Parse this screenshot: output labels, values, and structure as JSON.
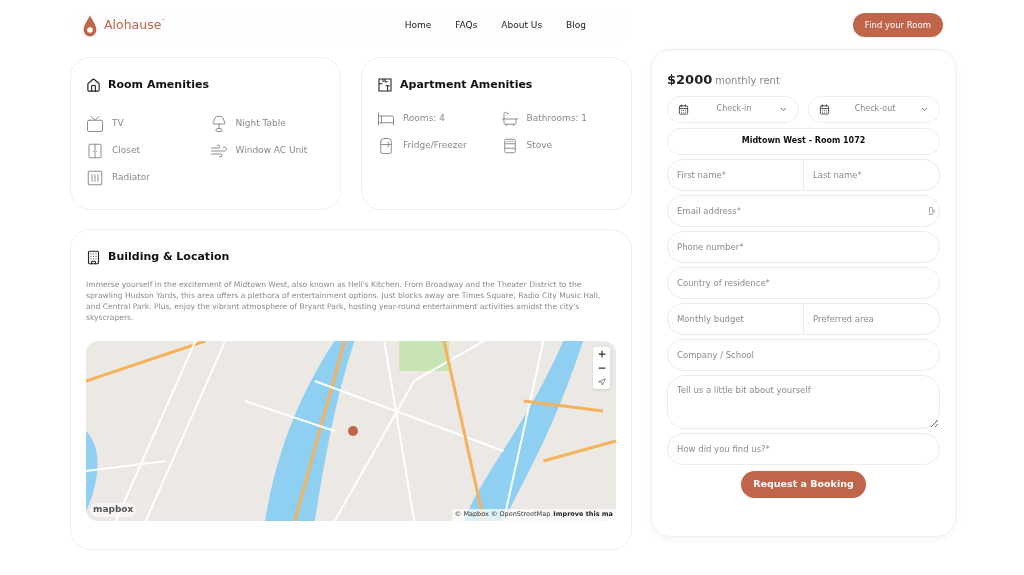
{
  "header": {
    "logo": "Alohause",
    "logo_mark": "™",
    "nav": [
      "Home",
      "FAQs",
      "About Us",
      "Blog"
    ],
    "cta": "Find your Room"
  },
  "room_amenities": {
    "title": "Room Amenities",
    "items": [
      {
        "kind": "tv",
        "label": "TV"
      },
      {
        "kind": "lamp",
        "label": "Night Table"
      },
      {
        "kind": "closet",
        "label": "Closet"
      },
      {
        "kind": "ac",
        "label": "Window AC Unit"
      },
      {
        "kind": "radiator",
        "label": "Radiator"
      }
    ]
  },
  "apartment_amenities": {
    "title": "Apartment Amenities",
    "items": [
      {
        "kind": "bed",
        "label": "Rooms: 4"
      },
      {
        "kind": "bath",
        "label": "Bathrooms: 1"
      },
      {
        "kind": "fridge",
        "label": "Fridge/Freezer"
      },
      {
        "kind": "stove",
        "label": "Stove"
      }
    ]
  },
  "building": {
    "title": "Building & Location",
    "description": "Immerse yourself in the excitement of Midtown West, also known as Hell's Kitchen. From Broadway and the Theater District to the sprawling Hudson Yards, this area offers a plethora of entertainment options. Just blocks away are Times Square, Radio City Music Hall, and Central Park. Plus, enjoy the vibrant atmosphere of Bryant Park, hosting year-round entertainment activities amidst the city's skyscrapers.",
    "map": {
      "logo": "mapbox",
      "attribution": "© Mapbox © OpenStreetMap",
      "improve": "Improve this ma"
    }
  },
  "booking": {
    "price": "$2000",
    "price_suffix": "monthly rent",
    "checkin": "Check-in",
    "checkout": "Check-out",
    "room": "Midtown West - Room 1072",
    "fields": [
      {
        "kind": "pair",
        "placeholders": [
          "First name*",
          "Last name*"
        ]
      },
      {
        "kind": "email",
        "placeholder": "Email address*"
      },
      {
        "kind": "text",
        "placeholder": "Phone number*"
      },
      {
        "kind": "text",
        "placeholder": "Country of residence*"
      },
      {
        "kind": "pair",
        "placeholders": [
          "Monthly budget",
          "Preferred area"
        ]
      },
      {
        "kind": "text",
        "placeholder": "Company / School"
      },
      {
        "kind": "textarea",
        "placeholder": "Tell us a little bit about yourself"
      },
      {
        "kind": "text",
        "placeholder": "How did you find us?*"
      }
    ],
    "submit": "Request a Booking"
  }
}
